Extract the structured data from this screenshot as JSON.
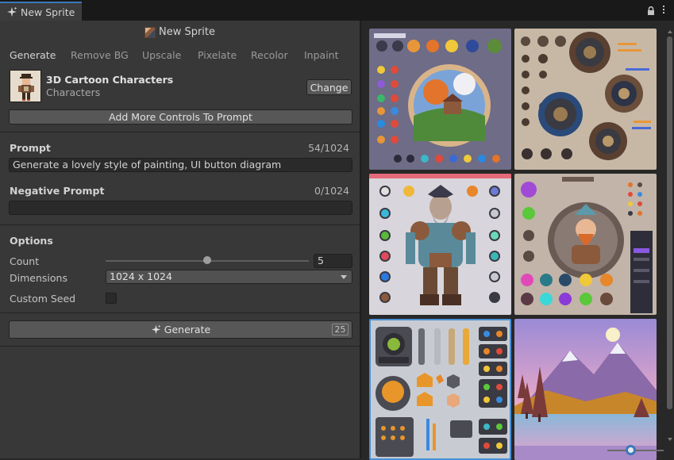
{
  "window": {
    "tab_title": "New Sprite"
  },
  "header": {
    "title": "New Sprite"
  },
  "tabs": [
    {
      "label": "Generate",
      "active": true
    },
    {
      "label": "Remove BG",
      "active": false
    },
    {
      "label": "Upscale",
      "active": false
    },
    {
      "label": "Pixelate",
      "active": false
    },
    {
      "label": "Recolor",
      "active": false
    },
    {
      "label": "Inpaint",
      "active": false
    }
  ],
  "model": {
    "name": "3D Cartoon Characters",
    "category": "Characters",
    "change_label": "Change"
  },
  "add_controls_label": "Add More Controls To Prompt",
  "prompt": {
    "label": "Prompt",
    "count": "54/1024",
    "value": "Generate a lovely style of painting, UI button diagram"
  },
  "negative_prompt": {
    "label": "Negative Prompt",
    "count": "0/1024",
    "value": ""
  },
  "options": {
    "title": "Options",
    "count_label": "Count",
    "count_value": "5",
    "count_slider_fraction": 0.5,
    "dimensions_label": "Dimensions",
    "dimensions_value": "1024 x 1024",
    "custom_seed_label": "Custom Seed",
    "custom_seed_checked": false
  },
  "generate": {
    "label": "Generate",
    "cost": "25"
  },
  "gallery": [
    {
      "subject": "ui-buttons-landscape-medallion",
      "selected": false
    },
    {
      "subject": "ui-buttons-round-knobs",
      "selected": false
    },
    {
      "subject": "dwarf-warrior-character-sheet",
      "selected": false
    },
    {
      "subject": "dwarf-portrait-ui-kit",
      "selected": false
    },
    {
      "subject": "game-ui-buttons-sheet",
      "selected": true
    },
    {
      "subject": "mountain-lake-landscape",
      "selected": false
    }
  ],
  "colors": {
    "accent": "#3a79bb",
    "panel": "#383838",
    "selected_border": "#4a90d6"
  }
}
